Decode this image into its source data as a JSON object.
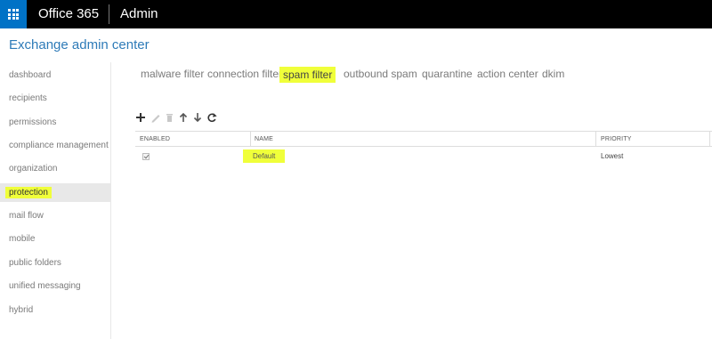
{
  "topbar": {
    "brand": "Office 365",
    "app": "Admin",
    "waffle_icon": "app-launcher-icon"
  },
  "header": {
    "title": "Exchange admin center"
  },
  "sidebar": {
    "items": [
      {
        "label": "dashboard"
      },
      {
        "label": "recipients"
      },
      {
        "label": "permissions"
      },
      {
        "label": "compliance management"
      },
      {
        "label": "organization"
      },
      {
        "label": "protection",
        "active": true
      },
      {
        "label": "mail flow"
      },
      {
        "label": "mobile"
      },
      {
        "label": "public folders"
      },
      {
        "label": "unified messaging"
      },
      {
        "label": "hybrid"
      }
    ]
  },
  "tabs": [
    {
      "label": "malware filter"
    },
    {
      "label": "connection filter"
    },
    {
      "label": "spam filter",
      "active": true
    },
    {
      "label": "outbound spam"
    },
    {
      "label": "quarantine"
    },
    {
      "label": "action center"
    },
    {
      "label": "dkim"
    }
  ],
  "toolbar": {
    "icons": [
      "add-icon",
      "edit-icon",
      "delete-icon",
      "move-up-icon",
      "move-down-icon",
      "refresh-icon"
    ]
  },
  "table": {
    "columns": [
      "ENABLED",
      "NAME",
      "PRIORITY"
    ],
    "rows": [
      {
        "enabled": true,
        "name": "Default",
        "priority": "Lowest"
      }
    ]
  },
  "colors": {
    "topbar": "#000000",
    "waffle": "#0072c6",
    "title": "#2e7bb8",
    "highlight": "#f0ff3a"
  }
}
